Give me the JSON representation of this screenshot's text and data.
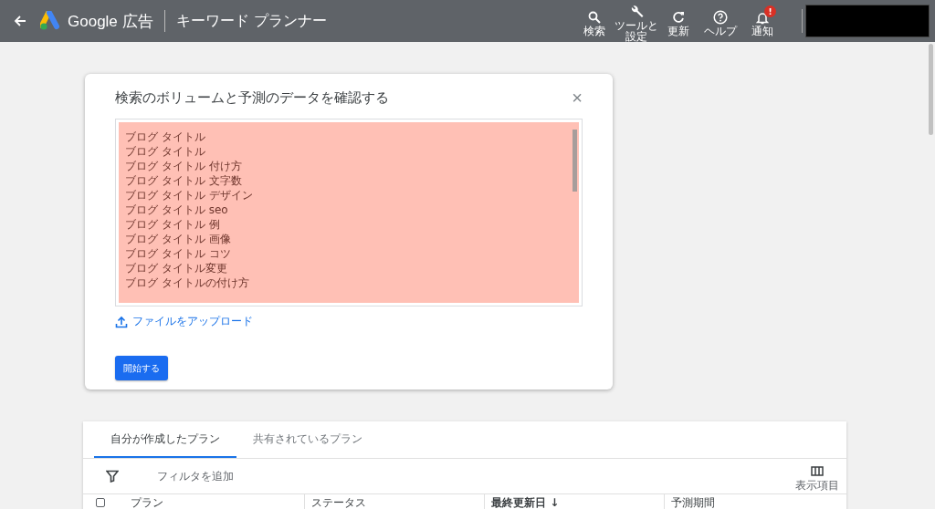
{
  "header": {
    "brand": "Google 広告",
    "page_title": "キーワード プランナー",
    "actions": [
      {
        "kind": "search",
        "label": "検索"
      },
      {
        "kind": "tools",
        "label": "ツールと設定"
      },
      {
        "kind": "refresh",
        "label": "更新"
      },
      {
        "kind": "help",
        "label": "ヘルプ"
      },
      {
        "kind": "bell",
        "label": "通知",
        "badge": "!"
      }
    ]
  },
  "dialog": {
    "title": "検索のボリュームと予測のデータを確認する",
    "close": "×",
    "keywords": [
      "ブログ タイトル",
      "ブログ タイトル",
      "ブログ タイトル 付け方",
      "ブログ タイトル 文字数",
      "ブログ タイトル デザイン",
      "ブログ タイトル seo",
      "ブログ タイトル 例",
      "ブログ タイトル 画像",
      "ブログ タイトル コツ",
      "ブログ タイトル変更",
      "ブログ タイトルの付け方"
    ],
    "upload_link": "ファイルをアップロード",
    "start_button": "開始する"
  },
  "plans": {
    "tabs": [
      {
        "label": "自分が作成したプラン",
        "selected": true
      },
      {
        "label": "共有されているプラン",
        "selected": false
      }
    ],
    "filter_placeholder": "フィルタを追加",
    "columns_button": "表示項目",
    "select_all": {
      "checked": false
    },
    "columns": [
      "プラン",
      "ステータス",
      "最終更新日 ↓",
      "予測期間"
    ]
  }
}
